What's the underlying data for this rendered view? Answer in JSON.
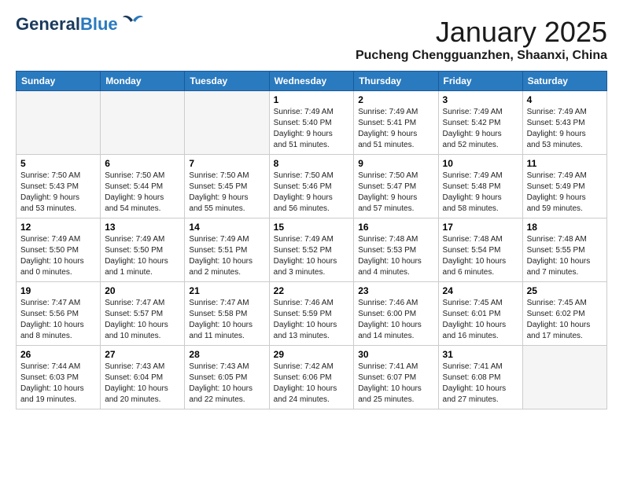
{
  "header": {
    "logo_line1": "General",
    "logo_line2": "Blue",
    "month_title": "January 2025",
    "location": "Pucheng Chengguanzhen, Shaanxi, China"
  },
  "weekdays": [
    "Sunday",
    "Monday",
    "Tuesday",
    "Wednesday",
    "Thursday",
    "Friday",
    "Saturday"
  ],
  "weeks": [
    [
      {
        "day": "",
        "info": ""
      },
      {
        "day": "",
        "info": ""
      },
      {
        "day": "",
        "info": ""
      },
      {
        "day": "1",
        "info": "Sunrise: 7:49 AM\nSunset: 5:40 PM\nDaylight: 9 hours\nand 51 minutes."
      },
      {
        "day": "2",
        "info": "Sunrise: 7:49 AM\nSunset: 5:41 PM\nDaylight: 9 hours\nand 51 minutes."
      },
      {
        "day": "3",
        "info": "Sunrise: 7:49 AM\nSunset: 5:42 PM\nDaylight: 9 hours\nand 52 minutes."
      },
      {
        "day": "4",
        "info": "Sunrise: 7:49 AM\nSunset: 5:43 PM\nDaylight: 9 hours\nand 53 minutes."
      }
    ],
    [
      {
        "day": "5",
        "info": "Sunrise: 7:50 AM\nSunset: 5:43 PM\nDaylight: 9 hours\nand 53 minutes."
      },
      {
        "day": "6",
        "info": "Sunrise: 7:50 AM\nSunset: 5:44 PM\nDaylight: 9 hours\nand 54 minutes."
      },
      {
        "day": "7",
        "info": "Sunrise: 7:50 AM\nSunset: 5:45 PM\nDaylight: 9 hours\nand 55 minutes."
      },
      {
        "day": "8",
        "info": "Sunrise: 7:50 AM\nSunset: 5:46 PM\nDaylight: 9 hours\nand 56 minutes."
      },
      {
        "day": "9",
        "info": "Sunrise: 7:50 AM\nSunset: 5:47 PM\nDaylight: 9 hours\nand 57 minutes."
      },
      {
        "day": "10",
        "info": "Sunrise: 7:49 AM\nSunset: 5:48 PM\nDaylight: 9 hours\nand 58 minutes."
      },
      {
        "day": "11",
        "info": "Sunrise: 7:49 AM\nSunset: 5:49 PM\nDaylight: 9 hours\nand 59 minutes."
      }
    ],
    [
      {
        "day": "12",
        "info": "Sunrise: 7:49 AM\nSunset: 5:50 PM\nDaylight: 10 hours\nand 0 minutes."
      },
      {
        "day": "13",
        "info": "Sunrise: 7:49 AM\nSunset: 5:50 PM\nDaylight: 10 hours\nand 1 minute."
      },
      {
        "day": "14",
        "info": "Sunrise: 7:49 AM\nSunset: 5:51 PM\nDaylight: 10 hours\nand 2 minutes."
      },
      {
        "day": "15",
        "info": "Sunrise: 7:49 AM\nSunset: 5:52 PM\nDaylight: 10 hours\nand 3 minutes."
      },
      {
        "day": "16",
        "info": "Sunrise: 7:48 AM\nSunset: 5:53 PM\nDaylight: 10 hours\nand 4 minutes."
      },
      {
        "day": "17",
        "info": "Sunrise: 7:48 AM\nSunset: 5:54 PM\nDaylight: 10 hours\nand 6 minutes."
      },
      {
        "day": "18",
        "info": "Sunrise: 7:48 AM\nSunset: 5:55 PM\nDaylight: 10 hours\nand 7 minutes."
      }
    ],
    [
      {
        "day": "19",
        "info": "Sunrise: 7:47 AM\nSunset: 5:56 PM\nDaylight: 10 hours\nand 8 minutes."
      },
      {
        "day": "20",
        "info": "Sunrise: 7:47 AM\nSunset: 5:57 PM\nDaylight: 10 hours\nand 10 minutes."
      },
      {
        "day": "21",
        "info": "Sunrise: 7:47 AM\nSunset: 5:58 PM\nDaylight: 10 hours\nand 11 minutes."
      },
      {
        "day": "22",
        "info": "Sunrise: 7:46 AM\nSunset: 5:59 PM\nDaylight: 10 hours\nand 13 minutes."
      },
      {
        "day": "23",
        "info": "Sunrise: 7:46 AM\nSunset: 6:00 PM\nDaylight: 10 hours\nand 14 minutes."
      },
      {
        "day": "24",
        "info": "Sunrise: 7:45 AM\nSunset: 6:01 PM\nDaylight: 10 hours\nand 16 minutes."
      },
      {
        "day": "25",
        "info": "Sunrise: 7:45 AM\nSunset: 6:02 PM\nDaylight: 10 hours\nand 17 minutes."
      }
    ],
    [
      {
        "day": "26",
        "info": "Sunrise: 7:44 AM\nSunset: 6:03 PM\nDaylight: 10 hours\nand 19 minutes."
      },
      {
        "day": "27",
        "info": "Sunrise: 7:43 AM\nSunset: 6:04 PM\nDaylight: 10 hours\nand 20 minutes."
      },
      {
        "day": "28",
        "info": "Sunrise: 7:43 AM\nSunset: 6:05 PM\nDaylight: 10 hours\nand 22 minutes."
      },
      {
        "day": "29",
        "info": "Sunrise: 7:42 AM\nSunset: 6:06 PM\nDaylight: 10 hours\nand 24 minutes."
      },
      {
        "day": "30",
        "info": "Sunrise: 7:41 AM\nSunset: 6:07 PM\nDaylight: 10 hours\nand 25 minutes."
      },
      {
        "day": "31",
        "info": "Sunrise: 7:41 AM\nSunset: 6:08 PM\nDaylight: 10 hours\nand 27 minutes."
      },
      {
        "day": "",
        "info": ""
      }
    ]
  ]
}
